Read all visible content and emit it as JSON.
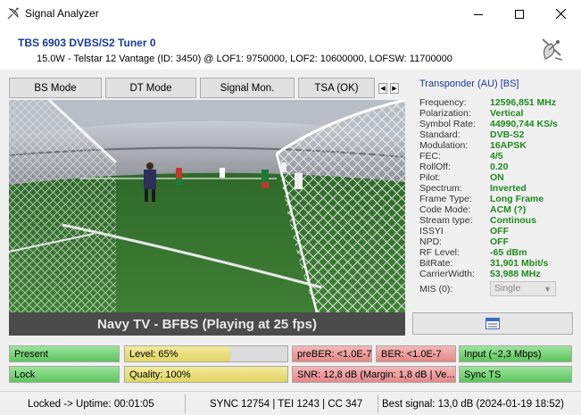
{
  "window": {
    "title": "Signal Analyzer",
    "controls": [
      "minimize",
      "maximize",
      "close"
    ]
  },
  "header": {
    "tuner": "TBS 6903 DVBS/S2 Tuner 0",
    "satellite": "15.0W - Telstar 12 Vantage (ID: 3450) @ LOF1: 9750000, LOF2: 10600000, LOFSW: 11700000"
  },
  "modes": {
    "tabs": [
      "BS Mode",
      "DT Mode",
      "Signal Mon.",
      "TSA (OK)"
    ]
  },
  "video": {
    "caption": "Navy TV - BFBS (Playing at 25 fps)"
  },
  "transponder": {
    "title": "Transponder (AU) [BS]",
    "fields": [
      {
        "label": "Frequency:",
        "value": "12596,851 MHz"
      },
      {
        "label": "Polarization:",
        "value": "Vertical"
      },
      {
        "label": "Symbol Rate:",
        "value": "44990,744 KS/s"
      },
      {
        "label": "Standard:",
        "value": "DVB-S2"
      },
      {
        "label": "Modulation:",
        "value": "16APSK"
      },
      {
        "label": "FEC:",
        "value": "4/5"
      },
      {
        "label": "RollOff:",
        "value": "0.20"
      },
      {
        "label": "Pilot:",
        "value": "ON"
      },
      {
        "label": "Spectrum:",
        "value": "Inverted"
      },
      {
        "label": "Frame Type:",
        "value": "Long Frame"
      },
      {
        "label": "Code Mode:",
        "value": "ACM (?)"
      },
      {
        "label": "Stream type:",
        "value": "Continous"
      },
      {
        "label": "ISSYI",
        "value": "OFF"
      },
      {
        "label": "NPD:",
        "value": "OFF"
      },
      {
        "label": "RF Level:",
        "value": "-65 dBm"
      },
      {
        "label": "BitRate:",
        "value": "31,901 Mbit/s"
      },
      {
        "label": "CarrierWidth:",
        "value": "53,988 MHz"
      }
    ],
    "mis_label": "MIS (0):",
    "mis_value": "Single"
  },
  "indicators": {
    "present": "Present",
    "lock": "Lock",
    "level": "Level: 65%",
    "level_fraction": 0.65,
    "quality": "Quality: 100%",
    "quality_fraction": 1.0,
    "preber": "preBER: <1.0E-7",
    "ber": "BER: <1.0E-7",
    "snr": "SNR: 12,8 dB (Margin: 1,8 dB | Ve...",
    "input": "Input (~2,3 Mbps)",
    "sync": "Sync TS"
  },
  "status": {
    "uptime": "Locked -> Uptime: 00:01:05",
    "counters": "SYNC 12754 | TEI 1243 | CC 347",
    "best": "Best signal: 13,0 dB (2024-01-19 18:52)"
  },
  "colors": {
    "accent_blue": "#1a3a9a",
    "value_green": "#1e8a1e",
    "ok_green": "#5ec45e",
    "warn_yellow": "#e1d562",
    "alert_red": "#e48888"
  }
}
